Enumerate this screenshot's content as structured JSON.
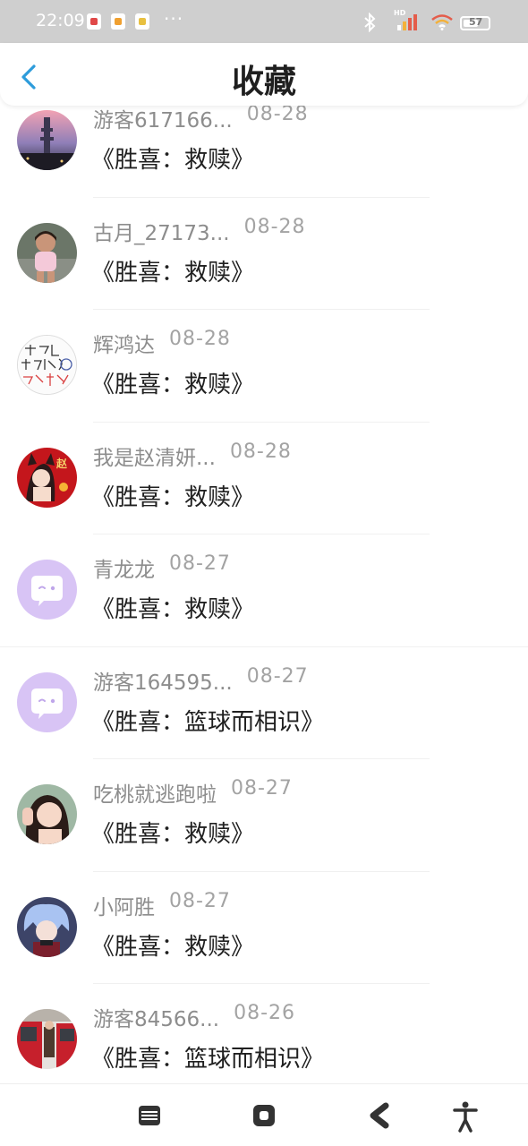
{
  "status_bar": {
    "time": "22:09",
    "dots": "···",
    "hd_label": "HD",
    "battery": "57"
  },
  "header": {
    "title": "收藏",
    "back_icon": "chevron-left-icon"
  },
  "items": [
    {
      "name": "游客617166...",
      "date": "08-28",
      "book": "《胜喜：救赎》",
      "avatar": "photo-city-tower"
    },
    {
      "name": "古月_27173...",
      "date": "08-28",
      "book": "《胜喜：救赎》",
      "avatar": "photo-child"
    },
    {
      "name": "辉鸿达",
      "date": "08-28",
      "book": "《胜喜：救赎》",
      "avatar": "handwriting-sketch"
    },
    {
      "name": "我是赵清妍...",
      "date": "08-28",
      "book": "《胜喜：救赎》",
      "avatar": "red-cartoon-girl"
    },
    {
      "name": "青龙龙",
      "date": "08-27",
      "book": "《胜喜：救赎》",
      "avatar": "default-chat-bubble"
    },
    {
      "name": "游客164595...",
      "date": "08-27",
      "book": "《胜喜：篮球而相识》",
      "avatar": "default-chat-bubble"
    },
    {
      "name": "吃桃就逃跑啦",
      "date": "08-27",
      "book": "《胜喜：救赎》",
      "avatar": "photo-girl-selfie"
    },
    {
      "name": "小阿胜",
      "date": "08-27",
      "book": "《胜喜：救赎》",
      "avatar": "anime-boy"
    },
    {
      "name": "游客84566...",
      "date": "08-26",
      "book": "《胜喜：篮球而相识》",
      "avatar": "photo-train"
    }
  ],
  "colors": {
    "accent": "#2d9cdb",
    "default_avatar": "#d8c4f5",
    "name_gray": "#8d8d8d"
  }
}
